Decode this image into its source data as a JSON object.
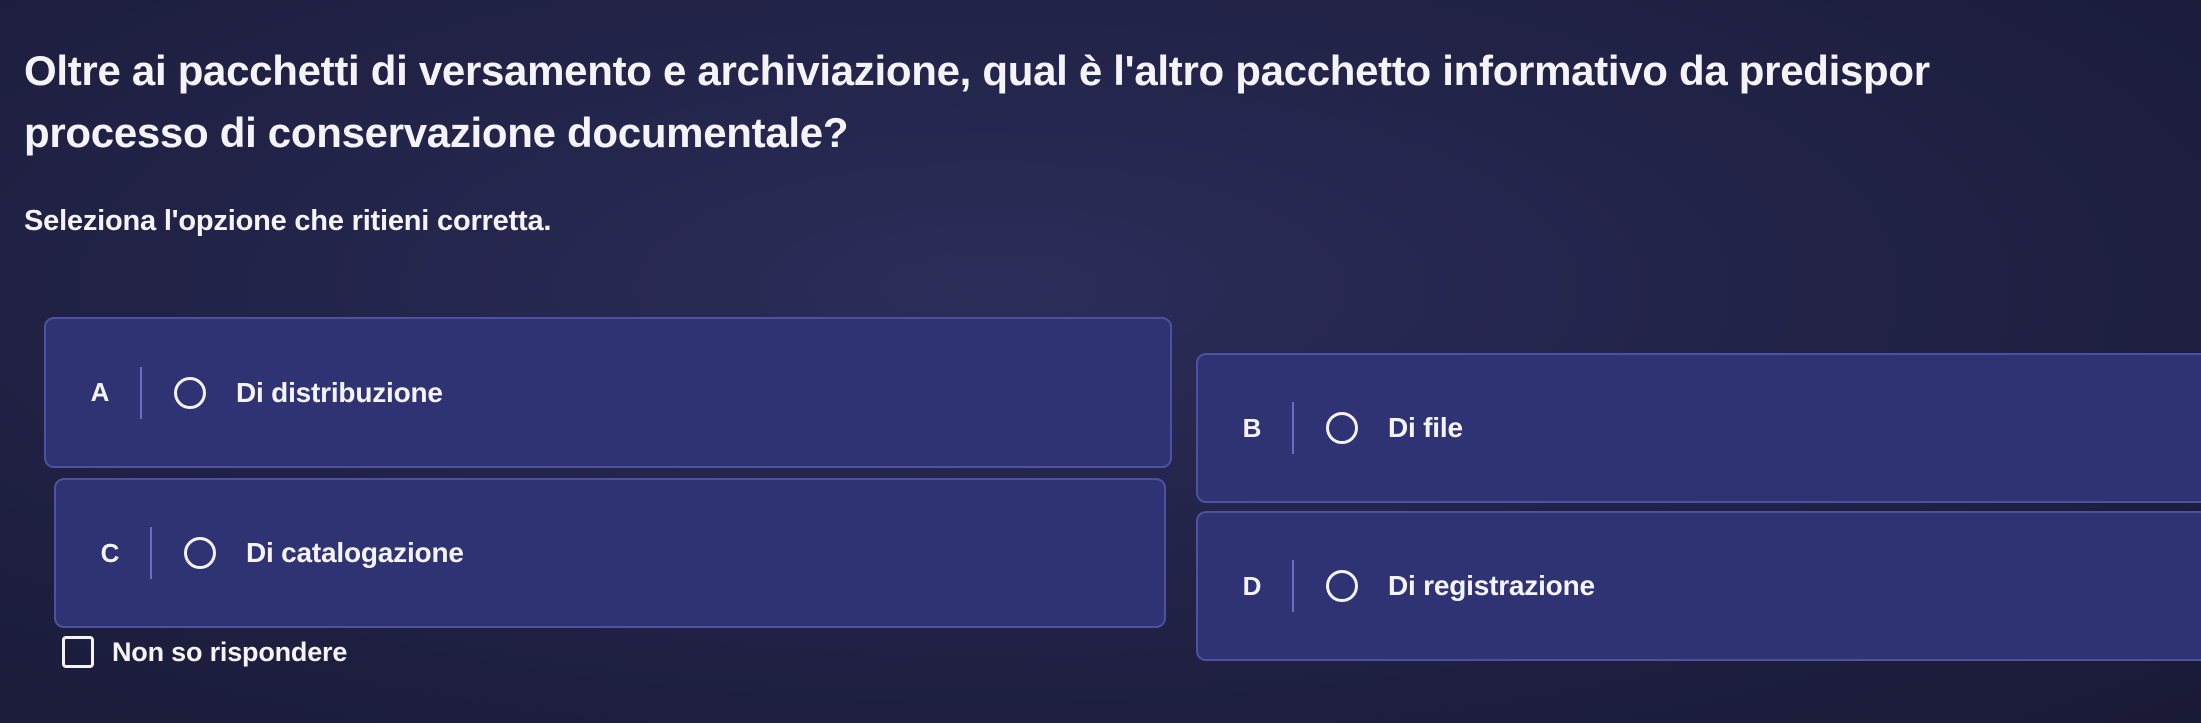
{
  "question": {
    "line1": "Oltre ai pacchetti di versamento e archiviazione, qual è l'altro pacchetto informativo da predispor",
    "line2": "processo di conservazione documentale?"
  },
  "instruction": "Seleziona l'opzione che ritieni corretta.",
  "options": [
    {
      "letter": "A",
      "label": "Di distribuzione"
    },
    {
      "letter": "B",
      "label": "Di file"
    },
    {
      "letter": "C",
      "label": "Di catalogazione"
    },
    {
      "letter": "D",
      "label": "Di registrazione"
    }
  ],
  "no_answer_label": "Non so rispondere",
  "colors": {
    "background": "#222348",
    "option_fill": "#2f3373",
    "option_border": "#4d52a0",
    "text": "#f4f4f8"
  },
  "icons": {
    "radio": "radio-circle-icon",
    "checkbox": "checkbox-square-icon"
  }
}
